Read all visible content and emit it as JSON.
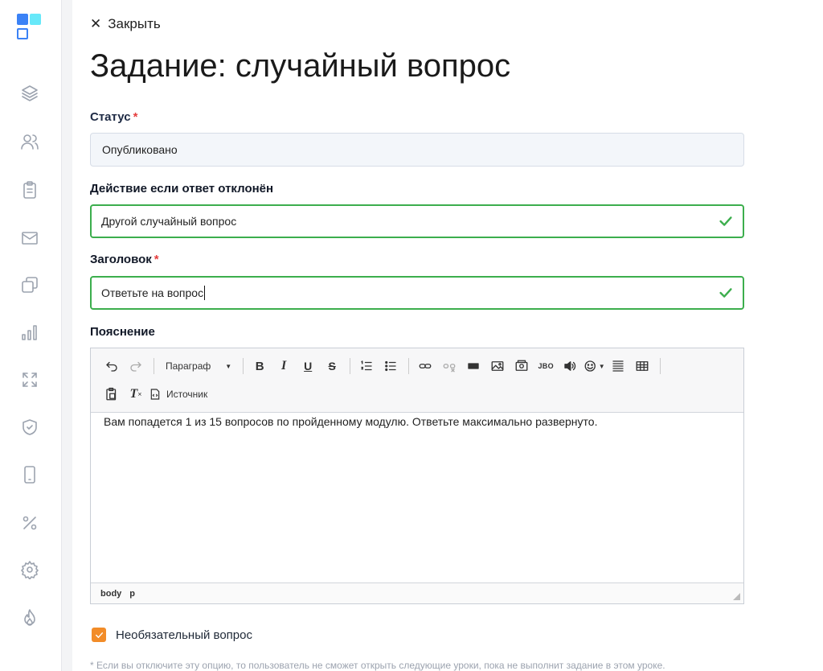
{
  "close_label": "Закрыть",
  "page_title": "Задание: случайный вопрос",
  "fields": {
    "status": {
      "label": "Статус",
      "required_mark": "*",
      "value": "Опубликовано"
    },
    "action": {
      "label": "Действие если ответ отклонён",
      "value": "Другой случайный вопрос"
    },
    "heading": {
      "label": "Заголовок",
      "required_mark": "*",
      "value": "Ответьте на вопрос"
    },
    "explanation": {
      "label": "Пояснение"
    }
  },
  "editor": {
    "format_select": "Параграф",
    "code_label": "JBO",
    "source_label": "Источник",
    "content": "Вам попадется 1 из 15 вопросов по пройденному модулю. Ответьте максимально развернуто.",
    "path": [
      "body",
      "p"
    ]
  },
  "optional_question": {
    "label": "Необязательный вопрос",
    "checked": true
  },
  "hint": "* Если вы отключите эту опцию, то пользователь не сможет открыть следующие уроки, пока не выполнит задание в этом уроке.",
  "colors": {
    "accent": "#3b82f6",
    "valid": "#3cae4d",
    "checkbox": "#f28c28",
    "required": "#e53e3e"
  },
  "sidebar_icons": [
    "layers-icon",
    "users-icon",
    "clipboard-icon",
    "mail-icon",
    "copy-icon",
    "bar-chart-icon",
    "expand-icon",
    "shield-icon",
    "phone-icon",
    "percent-icon",
    "gear-icon",
    "flame-icon"
  ]
}
